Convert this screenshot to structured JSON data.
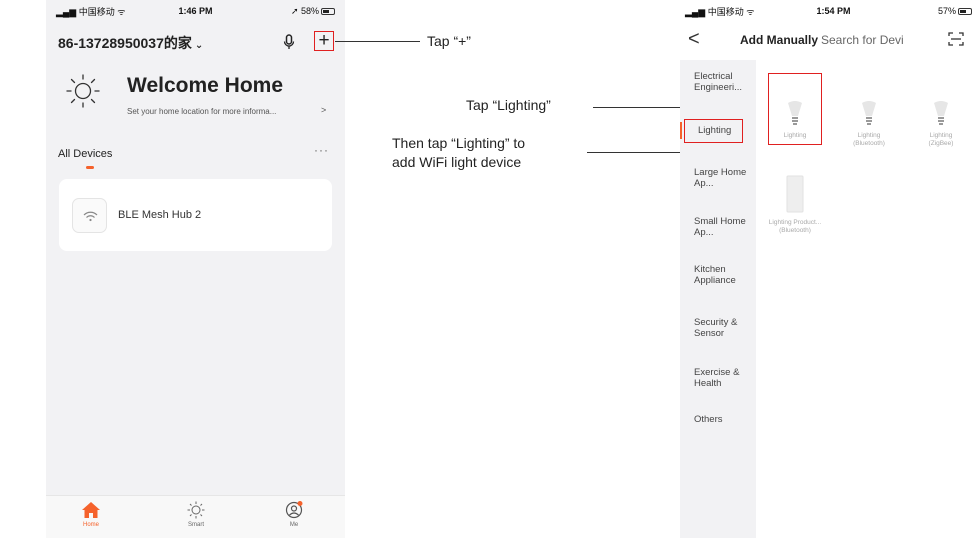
{
  "left_phone": {
    "status": {
      "carrier": "中国移动",
      "time": "1:46 PM",
      "battery": "58%"
    },
    "home_name": "86-13728950037的家",
    "welcome": "Welcome Home",
    "location_hint": "Set your home location for more informa...",
    "location_arrow": ">",
    "section_title": "All Devices",
    "more": "···",
    "device": {
      "name": "BLE Mesh Hub 2"
    },
    "add_symbol": "+",
    "tabs": [
      {
        "label": "Home",
        "icon": "home-icon"
      },
      {
        "label": "Smart",
        "icon": "sun-icon"
      },
      {
        "label": "Me",
        "icon": "person-icon"
      }
    ]
  },
  "annotations": {
    "tap_plus": "Tap “+”",
    "tap_lighting": "Tap “Lighting”",
    "then_tap_line1": "Then tap “Lighting” to",
    "then_tap_line2": "add WiFi light device"
  },
  "right_phone": {
    "status": {
      "carrier": "中国移动",
      "time": "1:54 PM",
      "battery": "57%"
    },
    "back": "<",
    "nav_tabs": [
      "Add Manually",
      "Search for Devi"
    ],
    "categories": [
      "Electrical Engineeri...",
      "Lighting",
      "Large Home Ap...",
      "Small Home Ap...",
      "Kitchen Appliance",
      "Security & Sensor",
      "Exercise & Health",
      "Others"
    ],
    "products": [
      {
        "name": "Lighting",
        "sub": ""
      },
      {
        "name": "Lighting",
        "sub": "(Bluetooth)"
      },
      {
        "name": "Lighting",
        "sub": "(ZigBee)"
      },
      {
        "name": "Lighting Product...",
        "sub": "(Bluetooth)"
      }
    ]
  },
  "colors": {
    "accent": "#f5622c",
    "highlight_box": "#e02020"
  }
}
